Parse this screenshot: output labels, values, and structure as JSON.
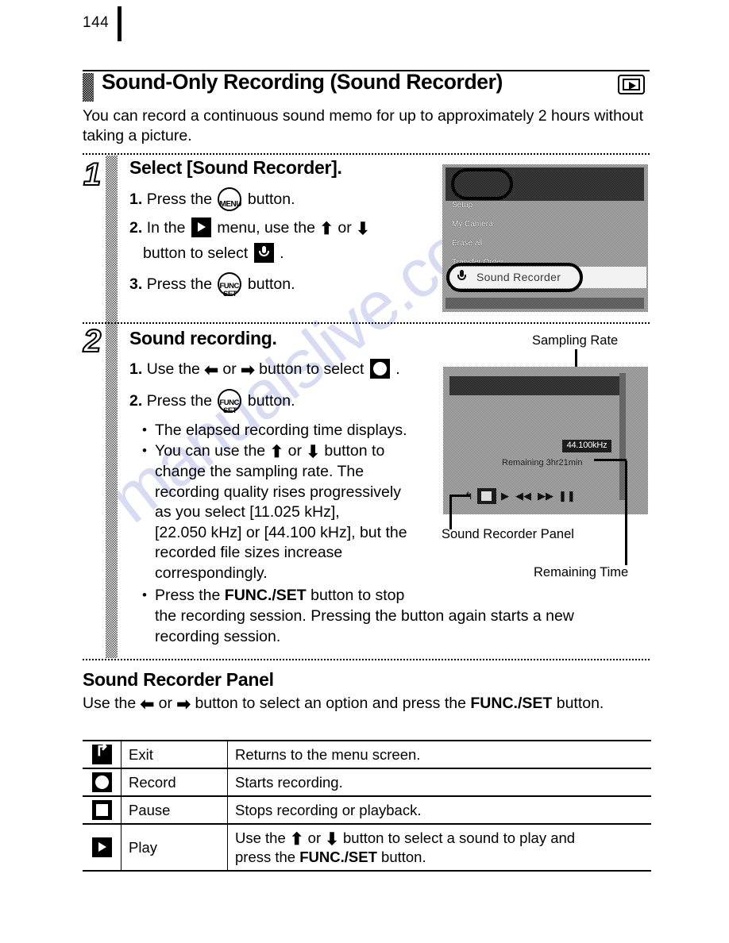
{
  "page": {
    "folio": "144"
  },
  "section": {
    "title": "Sound-Only Recording (Sound Recorder)",
    "title_icon": "playback-mode-icon",
    "intro": "You can record a continuous sound memo for up to approximately 2 hours without taking a picture."
  },
  "steps": [
    {
      "number": "1",
      "heading": "Select [Sound Recorder].",
      "items": [
        {
          "num": "1.",
          "pre": "Press the",
          "icon": "menu-button-icon",
          "post": "button."
        },
        {
          "num": "2.",
          "pre": "In the",
          "icon": "playback-mode-icon",
          "mid": "menu, use the",
          "up": "⬆",
          "or": "or",
          "down": "⬇",
          "post": "button to select",
          "icon2": "microphone-icon",
          "end": "."
        },
        {
          "num": "3.",
          "pre": "Press the",
          "icon": "func-set-button-icon",
          "post": "button."
        }
      ]
    },
    {
      "number": "2",
      "heading": "Sound recording.",
      "items": [
        {
          "num": "1.",
          "pre": "Use the",
          "left": "⬅",
          "or": "or",
          "right": "➡",
          "post": "button to select",
          "icon2": "record-icon",
          "end": "."
        },
        {
          "num": "2.",
          "pre": "Press the",
          "icon": "func-set-button-icon",
          "post": "button."
        }
      ],
      "bullets": [
        "The elapsed recording time displays.",
        "You can use the ⬆ or ⬇ button to change the sampling rate. The recording quality rises progressively as you select [11.025 kHz], [22.050 kHz] or [44.100 kHz], but the recorded file sizes increase correspondingly.",
        "Press the FUNC./SET button to stop the recording session. Pressing the button again starts a new recording session."
      ],
      "bullet2_parts": {
        "a": "You can use the",
        "up": "⬆",
        "or": "or",
        "down": "⬇",
        "b": "button to",
        "c": "change the sampling rate. The",
        "d": "recording quality rises progressively",
        "e": "as you select [11.025 kHz],",
        "f": "[22.050 kHz] or [44.100 kHz], but the",
        "g": "recorded file sizes increase",
        "h": "correspondingly."
      },
      "bullet3_parts": {
        "a": "Press the",
        "bold": "FUNC./SET",
        "b": "button to stop",
        "c": "the recording session. Pressing the button again starts a new",
        "d": "recording session."
      }
    }
  ],
  "lcd_menu": {
    "rows": [
      "Setup",
      "My Camera",
      "Erase all",
      "Transfer Order",
      "Sound Recorder"
    ],
    "selected": "Sound Recorder",
    "selected_icon": "microphone-icon",
    "highlight_top": "Setup"
  },
  "lcd_recorder": {
    "sampling_rate": "44.100kHz",
    "remaining_label": "Remaining 3hr21min",
    "panel_icons": [
      "exit-icon",
      "record-icon",
      "play-icon",
      "prev-icon",
      "next-icon",
      "pause-icon"
    ]
  },
  "callouts": {
    "sampling_rate": "Sampling Rate",
    "sound_recorder_panel": "Sound Recorder Panel",
    "remaining_time": "Remaining Time"
  },
  "panel_section": {
    "heading": "Sound Recorder Panel",
    "intro_a": "Use the",
    "intro_left": "⬅",
    "intro_or": "or",
    "intro_right": "➡",
    "intro_b": "button to select an option and press the",
    "intro_bold": "FUNC./SET",
    "intro_c": "button."
  },
  "table": {
    "rows": [
      {
        "icon": "exit-icon",
        "name": "Exit",
        "desc": "Returns to the menu screen."
      },
      {
        "icon": "record-icon",
        "name": "Record",
        "desc": "Starts recording."
      },
      {
        "icon": "pause-icon",
        "name": "Pause",
        "desc": "Stops recording or playback."
      },
      {
        "icon": "play-icon",
        "name": "Play",
        "desc_a": "Use the",
        "desc_up": "⬆",
        "desc_or": "or",
        "desc_down": "⬇",
        "desc_b": "button to select a sound to play and",
        "desc_c": "press the",
        "desc_bold": "FUNC./SET",
        "desc_d": "button."
      }
    ]
  },
  "watermark": {
    "text": "manualslive.com",
    "color": "#b9c0e8"
  }
}
